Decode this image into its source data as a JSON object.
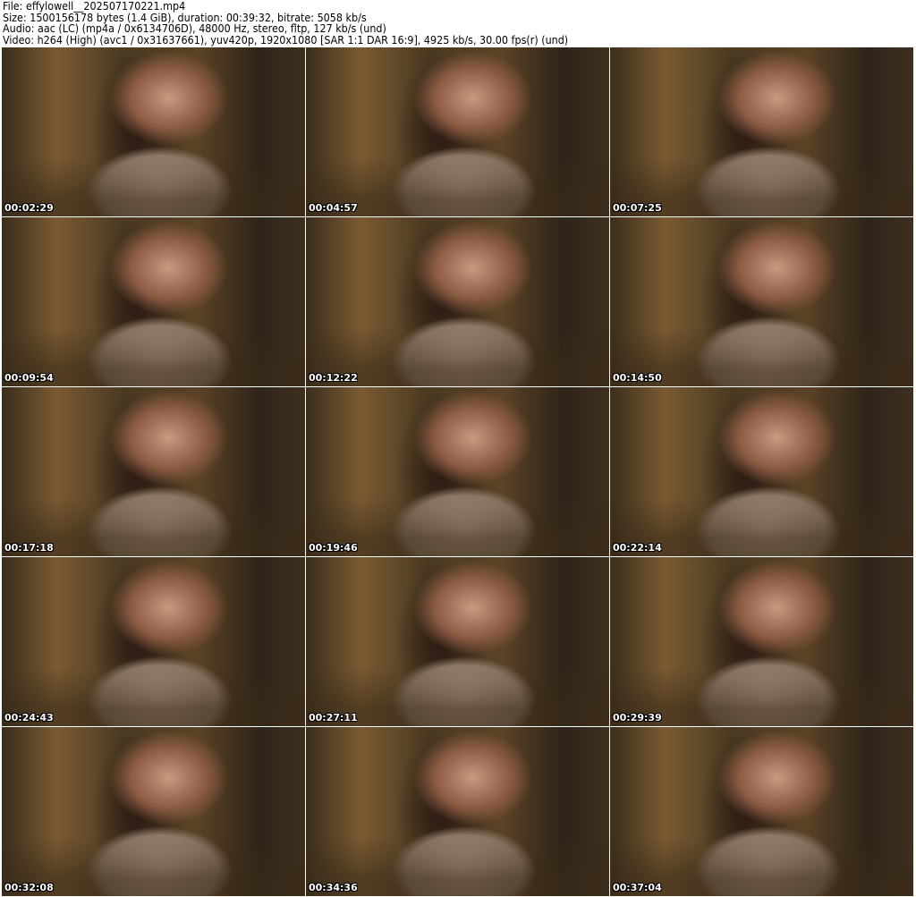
{
  "header": {
    "file": "File: effylowell__202507170221.mp4",
    "size": "Size: 1500156178 bytes (1.4 GiB), duration: 00:39:32, bitrate: 5058 kb/s",
    "audio": "Audio: aac (LC) (mp4a / 0x6134706D), 48000 Hz, stereo, fltp, 127 kb/s (und)",
    "video": "Video: h264 (High) (avc1 / 0x31637661), yuv420p, 1920x1080 [SAR 1:1 DAR 16:9], 4925 kb/s, 30.00 fps(r) (und)"
  },
  "thumbnails": [
    {
      "timestamp": "00:02:29"
    },
    {
      "timestamp": "00:04:57"
    },
    {
      "timestamp": "00:07:25"
    },
    {
      "timestamp": "00:09:54"
    },
    {
      "timestamp": "00:12:22"
    },
    {
      "timestamp": "00:14:50"
    },
    {
      "timestamp": "00:17:18"
    },
    {
      "timestamp": "00:19:46"
    },
    {
      "timestamp": "00:22:14"
    },
    {
      "timestamp": "00:24:43"
    },
    {
      "timestamp": "00:27:11"
    },
    {
      "timestamp": "00:29:39"
    },
    {
      "timestamp": "00:32:08"
    },
    {
      "timestamp": "00:34:36"
    },
    {
      "timestamp": "00:37:04"
    }
  ]
}
